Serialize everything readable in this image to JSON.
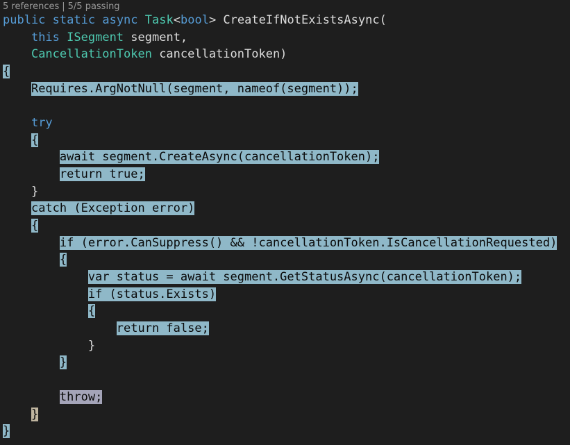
{
  "codelens": {
    "references": "5 references",
    "separator": "|",
    "tests": "5/5 passing"
  },
  "code": {
    "sig_public": "public",
    "sig_static": "static",
    "sig_async": "async",
    "sig_task": "Task",
    "sig_lt": "<",
    "sig_bool": "bool",
    "sig_gt": ">",
    "sig_name": " CreateIfNotExistsAsync(",
    "param1_this": "this",
    "param1_type": "ISegment",
    "param1_name": " segment,",
    "param2_type": "CancellationToken",
    "param2_name": " cancellationToken)",
    "open_brace": "{",
    "requires": "Requires.ArgNotNull(segment, nameof(segment));",
    "try": "try",
    "try_open": "{",
    "await_create": "await segment.CreateAsync(cancellationToken);",
    "return_true": "return true;",
    "try_close": "}",
    "catch": "catch (Exception error)",
    "catch_open": "{",
    "if_suppress": "if (error.CanSuppress() && !cancellationToken.IsCancellationRequested)",
    "if_open": "{",
    "var_status": "var status = await segment.GetStatusAsync(cancellationToken);",
    "if_exists": "if (status.Exists)",
    "exists_open": "{",
    "return_false": "return false;",
    "exists_close": "}",
    "if_close": "}",
    "throw": "throw;",
    "catch_close": "}",
    "close_brace": "}"
  },
  "colors": {
    "background": "#1e1e1e",
    "keyword": "#569cd6",
    "type": "#4ec9b0",
    "text": "#dcdcdc",
    "highlight": "#8fb8c8"
  }
}
